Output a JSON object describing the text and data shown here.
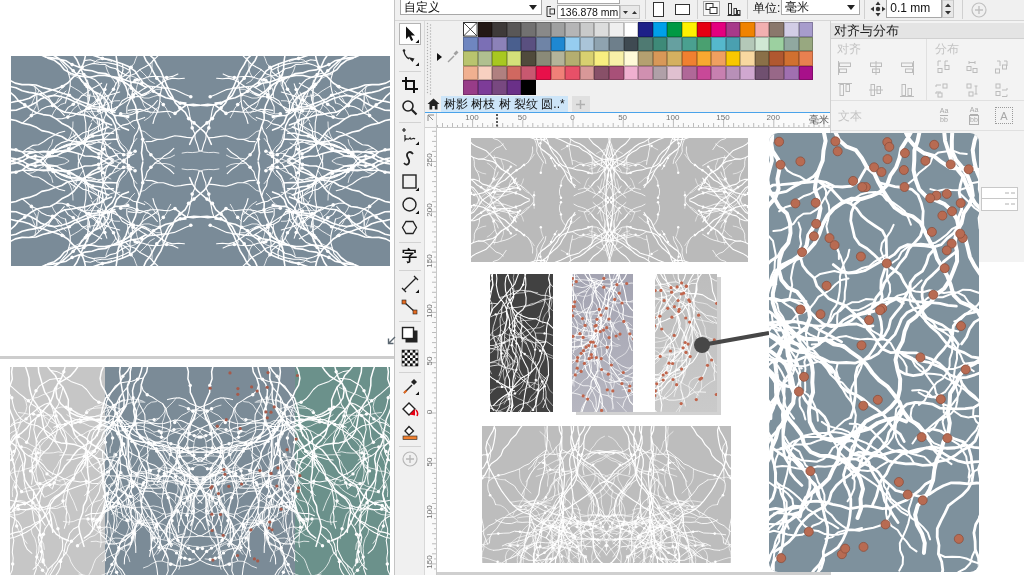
{
  "property_bar": {
    "preset": "自定义",
    "height_value": "136.878 mm",
    "unit_label": "单位:",
    "unit": "毫米",
    "nudge_value": "0.1 mm"
  },
  "toolbox": {
    "groups": [
      {
        "tools": [
          {
            "kind": "pick",
            "selected": true
          },
          {
            "kind": "shape",
            "selected": false
          }
        ]
      },
      {
        "tools": [
          {
            "kind": "crop",
            "selected": false
          },
          {
            "kind": "zoom",
            "selected": false
          }
        ]
      },
      {
        "tools": [
          {
            "kind": "freehand",
            "selected": false
          },
          {
            "kind": "artistic",
            "selected": false
          },
          {
            "kind": "rectangle",
            "selected": false
          },
          {
            "kind": "ellipse",
            "selected": false
          },
          {
            "kind": "polygon",
            "selected": false
          }
        ]
      },
      {
        "tools": [
          {
            "kind": "text",
            "glyph": "字",
            "selected": false
          }
        ]
      },
      {
        "tools": [
          {
            "kind": "dimension",
            "selected": false
          },
          {
            "kind": "connector",
            "selected": false
          }
        ]
      },
      {
        "tools": [
          {
            "kind": "shadow",
            "selected": false
          },
          {
            "kind": "transparency",
            "selected": false
          }
        ]
      },
      {
        "tools": [
          {
            "kind": "eyedropper",
            "selected": false
          },
          {
            "kind": "interactive-fill",
            "selected": false
          },
          {
            "kind": "smart-fill",
            "selected": false
          }
        ]
      }
    ]
  },
  "palette": {
    "swatches": [
      {
        "color": "#231815"
      },
      {
        "color": "#3e3a39"
      },
      {
        "color": "#595757"
      },
      {
        "color": "#727171"
      },
      {
        "color": "#898989"
      },
      {
        "color": "#9fa0a0"
      },
      {
        "color": "#b5b5b6"
      },
      {
        "color": "#c9caca"
      },
      {
        "color": "#dcdddd"
      },
      {
        "color": "#efefef"
      },
      {
        "color": "#ffffff"
      },
      {
        "color": "#1d2088"
      },
      {
        "color": "#00a0e9"
      },
      {
        "color": "#009944"
      },
      {
        "color": "#fff100"
      },
      {
        "color": "#e60012"
      },
      {
        "color": "#e4007f"
      },
      {
        "color": "#a73a8a"
      },
      {
        "color": "#f08300"
      },
      {
        "color": "#f2b0b0"
      },
      {
        "color": "#8a786c"
      },
      {
        "color": "#d2cde6"
      },
      {
        "color": "#a79ccc"
      },
      {
        "color": "#6f86c0"
      },
      {
        "color": "#7b6fb5"
      },
      {
        "color": "#8c82b8"
      },
      {
        "color": "#4a5f8e"
      },
      {
        "color": "#5a5080"
      },
      {
        "color": "#6f84a6"
      },
      {
        "color": "#1e88d2"
      },
      {
        "color": "#96cdf0"
      },
      {
        "color": "#aac4d8"
      },
      {
        "color": "#8fa3b0"
      },
      {
        "color": "#6e7f8b"
      },
      {
        "color": "#3f4a52"
      },
      {
        "color": "#4f7a72"
      },
      {
        "color": "#3e8a78"
      },
      {
        "color": "#66a0a0"
      },
      {
        "color": "#4aa090"
      },
      {
        "color": "#4aa070"
      },
      {
        "color": "#55b8cc"
      },
      {
        "color": "#4aa0b0"
      },
      {
        "color": "#b4c8b8"
      },
      {
        "color": "#d0e8d4"
      },
      {
        "color": "#9cd0a0"
      },
      {
        "color": "#90a8a0"
      },
      {
        "color": "#98a880"
      },
      {
        "color": "#b9c46e"
      },
      {
        "color": "#b0c090"
      },
      {
        "color": "#a8c820"
      },
      {
        "color": "#d4e07a"
      },
      {
        "color": "#504a3c"
      },
      {
        "color": "#8a8a78"
      },
      {
        "color": "#b4b49a"
      },
      {
        "color": "#b4ae70"
      },
      {
        "color": "#d8d070"
      },
      {
        "color": "#f8ee80"
      },
      {
        "color": "#f8f0a8"
      },
      {
        "color": "#fffad8"
      },
      {
        "color": "#b4a070"
      },
      {
        "color": "#d89858"
      },
      {
        "color": "#d4b060"
      },
      {
        "color": "#f08030"
      },
      {
        "color": "#f8a830"
      },
      {
        "color": "#f0a060"
      },
      {
        "color": "#f8c800"
      },
      {
        "color": "#f8d8a0"
      },
      {
        "color": "#8a7048"
      },
      {
        "color": "#b05830"
      },
      {
        "color": "#d07030"
      },
      {
        "color": "#e88050"
      },
      {
        "color": "#f0b090"
      },
      {
        "color": "#f8d0c0"
      },
      {
        "color": "#b08080"
      },
      {
        "color": "#d06860"
      },
      {
        "color": "#c85870"
      },
      {
        "color": "#e8104a"
      },
      {
        "color": "#f08078"
      },
      {
        "color": "#e85068"
      },
      {
        "color": "#d89898"
      },
      {
        "color": "#885068"
      },
      {
        "color": "#a85078"
      },
      {
        "color": "#f0b0d0"
      },
      {
        "color": "#d090b0"
      },
      {
        "color": "#b0a0a8"
      },
      {
        "color": "#e0c0d0"
      },
      {
        "color": "#b06898"
      },
      {
        "color": "#c84898"
      },
      {
        "color": "#c880b0"
      },
      {
        "color": "#b890b8"
      },
      {
        "color": "#d0a8d0"
      },
      {
        "color": "#705070"
      },
      {
        "color": "#986888"
      },
      {
        "color": "#a070b0"
      },
      {
        "color": "#a8108a"
      },
      {
        "color": "#983c88"
      },
      {
        "color": "#7d3c98"
      },
      {
        "color": "#784880"
      },
      {
        "color": "#6a3088"
      },
      {
        "color": "#000000"
      }
    ]
  },
  "document_tabs": [
    {
      "label": "树影 树枝 树 裂纹 圆..*",
      "selected": true
    }
  ],
  "rulers": {
    "horizontal": {
      "labels": [
        "100",
        "50",
        "0",
        "50",
        "100",
        "150",
        "200"
      ],
      "unit": "毫米"
    },
    "vertical": {
      "labels": [
        "250",
        "200",
        "150",
        "100",
        "50",
        "0",
        "50",
        "100",
        "150"
      ]
    }
  },
  "docker": {
    "title": "对齐与分布",
    "align": {
      "label": "对齐",
      "disabled": true,
      "buttons": [
        {
          "kind": "align-left"
        },
        {
          "kind": "align-center-h"
        },
        {
          "kind": "align-right"
        },
        {
          "kind": "align-top"
        },
        {
          "kind": "align-center-v"
        },
        {
          "kind": "align-bottom"
        }
      ]
    },
    "distribute": {
      "label": "分布",
      "disabled": true,
      "buttons": [
        {
          "kind": "distribute-left"
        },
        {
          "kind": "distribute-center-h"
        },
        {
          "kind": "distribute-right"
        },
        {
          "kind": "distribute-top"
        },
        {
          "kind": "distribute-center-v"
        },
        {
          "kind": "distribute-bottom"
        }
      ]
    },
    "text": {
      "label": "文本",
      "disabled": true,
      "buttons": [
        {
          "kind": "stacked",
          "glyphs": [
            "Aa",
            "bb"
          ]
        },
        {
          "kind": "boxed",
          "glyphs": [
            "Aa",
            "bb"
          ]
        },
        {
          "kind": "dotted",
          "glyphs": [
            "A"
          ]
        }
      ]
    }
  }
}
